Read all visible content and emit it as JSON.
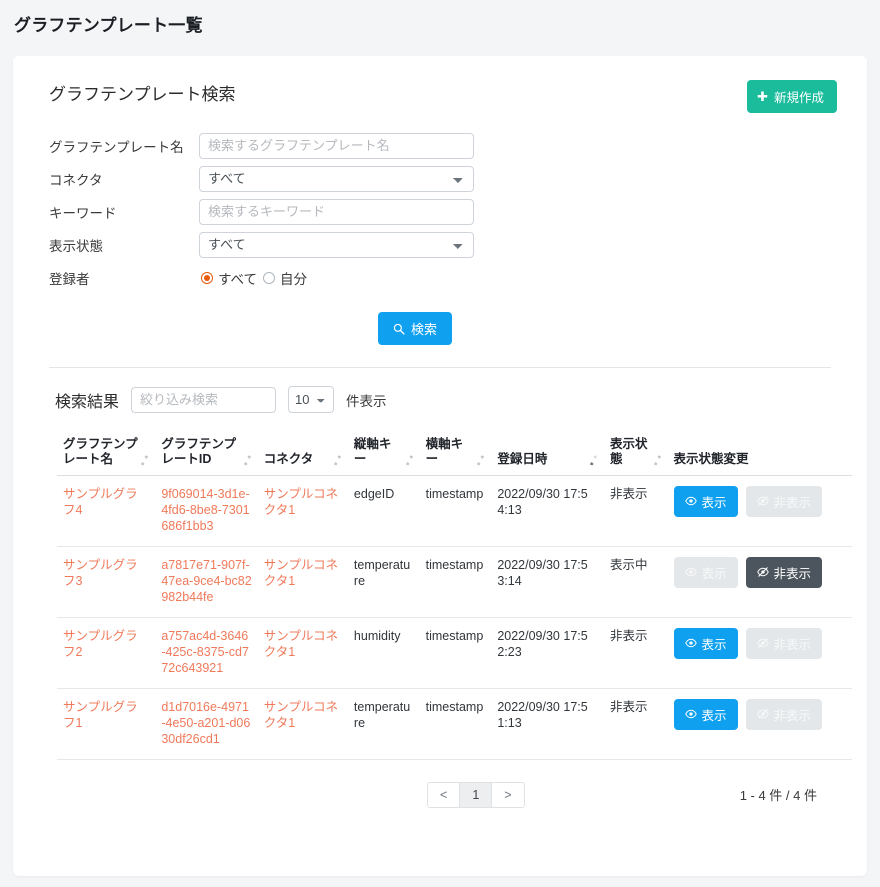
{
  "page": {
    "title": "グラフテンプレート一覧"
  },
  "search_panel": {
    "title": "グラフテンプレート検索",
    "new_button": {
      "label": "新規作成",
      "icon": "plus-icon",
      "color": "#1abc9c"
    },
    "fields": {
      "name": {
        "label": "グラフテンプレート名",
        "placeholder": "検索するグラフテンプレート名",
        "value": ""
      },
      "connector": {
        "label": "コネクタ",
        "selected": "すべて"
      },
      "keyword": {
        "label": "キーワード",
        "placeholder": "検索するキーワード",
        "value": ""
      },
      "display_state": {
        "label": "表示状態",
        "selected": "すべて"
      },
      "registrant": {
        "label": "登録者",
        "options": [
          {
            "label": "すべて",
            "selected": true
          },
          {
            "label": "自分",
            "selected": false
          }
        ],
        "accent": "#e8590c"
      }
    },
    "search_button": {
      "label": "検索",
      "icon": "search-icon",
      "color": "#10a0f0"
    }
  },
  "results": {
    "title": "検索結果",
    "filter_placeholder": "絞り込み検索",
    "filter_value": "",
    "page_length": "10",
    "page_length_suffix": "件表示",
    "columns": [
      {
        "label": "グラフテンプレート名",
        "sort": "none"
      },
      {
        "label": "グラフテンプレートID",
        "sort": "none"
      },
      {
        "label": "コネクタ",
        "sort": "none"
      },
      {
        "label": "縦軸キー",
        "sort": "none"
      },
      {
        "label": "横軸キー",
        "sort": "none"
      },
      {
        "label": "登録日時",
        "sort": "desc"
      },
      {
        "label": "表示状態",
        "sort": "none"
      },
      {
        "label": "表示状態変更",
        "sort": "none"
      }
    ],
    "rows": [
      {
        "name": "サンプルグラフ4",
        "id": "9f069014-3d1e-4fd6-8be8-7301686f1bb3",
        "connector": "サンプルコネクタ1",
        "y_key": "edgeID",
        "x_key": "timestamp",
        "registered_at": "2022/09/30 17:54:13",
        "state": "非表示",
        "show_button": {
          "label": "表示",
          "icon": "eye-icon",
          "enabled": true
        },
        "hide_button": {
          "label": "非表示",
          "icon": "eye-slash-icon",
          "enabled": false
        }
      },
      {
        "name": "サンプルグラフ3",
        "id": "a7817e71-907f-47ea-9ce4-bc82982b44fe",
        "connector": "サンプルコネクタ1",
        "y_key": "temperature",
        "x_key": "timestamp",
        "registered_at": "2022/09/30 17:53:14",
        "state": "表示中",
        "show_button": {
          "label": "表示",
          "icon": "eye-icon",
          "enabled": false
        },
        "hide_button": {
          "label": "非表示",
          "icon": "eye-slash-icon",
          "enabled": true
        }
      },
      {
        "name": "サンプルグラフ2",
        "id": "a757ac4d-3646-425c-8375-cd772c643921",
        "connector": "サンプルコネクタ1",
        "y_key": "humidity",
        "x_key": "timestamp",
        "registered_at": "2022/09/30 17:52:23",
        "state": "非表示",
        "show_button": {
          "label": "表示",
          "icon": "eye-icon",
          "enabled": true
        },
        "hide_button": {
          "label": "非表示",
          "icon": "eye-slash-icon",
          "enabled": false
        }
      },
      {
        "name": "サンプルグラフ1",
        "id": "d1d7016e-4971-4e50-a201-d0630df26cd1",
        "connector": "サンプルコネクタ1",
        "y_key": "temperature",
        "x_key": "timestamp",
        "registered_at": "2022/09/30 17:51:13",
        "state": "非表示",
        "show_button": {
          "label": "表示",
          "icon": "eye-icon",
          "enabled": true
        },
        "hide_button": {
          "label": "非表示",
          "icon": "eye-slash-icon",
          "enabled": false
        }
      }
    ],
    "pagination": {
      "prev": "<",
      "pages": [
        "1"
      ],
      "next": ">",
      "current": "1"
    },
    "count_text": "1 - 4 件 / 4 件"
  }
}
